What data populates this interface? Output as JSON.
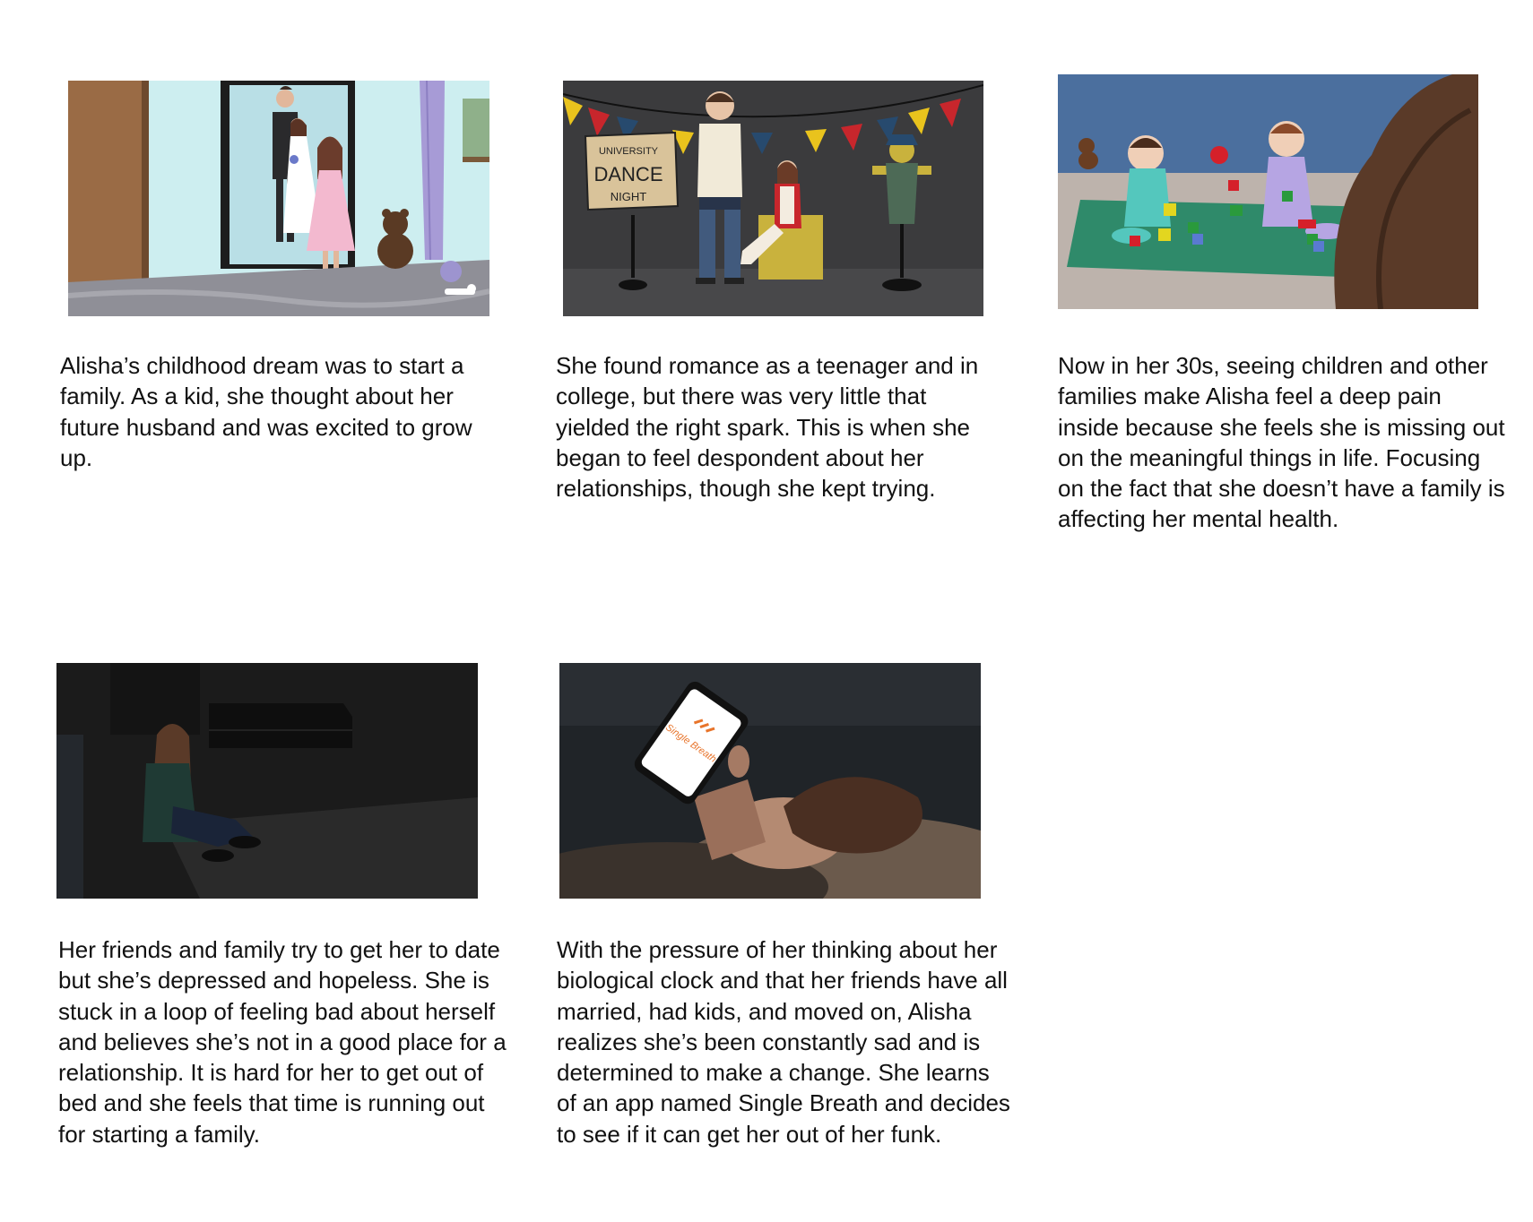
{
  "panels": [
    {
      "caption": "Alisha’s childhood dream was to start a family. As a kid, she thought about her future husband and was excited to grow up."
    },
    {
      "caption": "She found romance as a teenager and in college, but there was very little that yielded the right spark. This is when she began to feel despondent about her relationships, though she kept trying.",
      "sign": [
        "UNIVERSITY",
        "DANCE",
        "NIGHT"
      ]
    },
    {
      "caption": "Now in her 30s, seeing children and other families make Alisha feel a deep pain inside because she feels she is missing out on the meaningful things in life. Focusing on the fact that she doesn’t have a family is affecting her mental health."
    },
    {
      "caption": "Her friends and family try to get her to date but she’s depressed and hopeless. She is stuck in a loop of feeling bad about herself and believes she’s not in a good place for a relationship. It is hard for her to get out of bed and she feels that time is running out for starting a family."
    },
    {
      "caption": "With the pressure of her thinking about her biological clock and that her friends have all married, had kids, and moved on, Alisha realizes she’s been constantly sad and is determined to make a change. She learns of an app named Single Breath and decides to see if it can get her out of her funk.",
      "app_logo": "Single Breath"
    }
  ],
  "colors": {
    "panel1_wall": "#cdeef0",
    "panel2_bg": "#3b3b3d",
    "panel3_wall": "#4b6f9e",
    "panel3_mat": "#2f8a6a",
    "panel4_bg": "#1b1b1b",
    "panel5_bg": "#202428",
    "app_accent": "#e8742a"
  }
}
